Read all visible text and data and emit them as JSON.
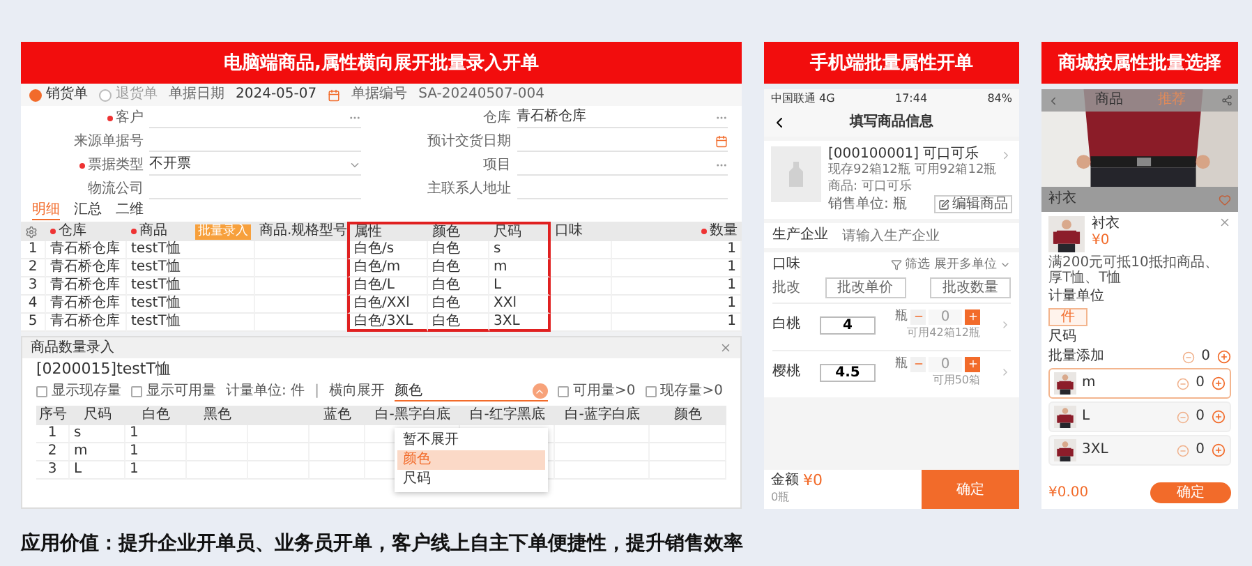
{
  "desktop": {
    "heading": "电脑端商品,属性横向展开批量录入开单",
    "bill_types": [
      {
        "label": "销货单",
        "selected": true
      },
      {
        "label": "退货单",
        "selected": false
      }
    ],
    "date_label": "单据日期",
    "date": "2024-05-07",
    "number_label": "单据编号",
    "number": "SA-20240507-004",
    "fields": [
      {
        "label": "客户",
        "required": true,
        "kind": "lookup"
      },
      {
        "label": "仓库",
        "required": false,
        "value": "青石桥仓库",
        "kind": "lookup"
      },
      {
        "label": "来源单据号",
        "required": false,
        "kind": "text"
      },
      {
        "label": "预计交货日期",
        "required": false,
        "kind": "date"
      },
      {
        "label": "票据类型",
        "required": true,
        "value": "不开票",
        "kind": "select"
      },
      {
        "label": "项目",
        "required": false,
        "kind": "lookup"
      },
      {
        "label": "物流公司",
        "required": false,
        "kind": "text"
      },
      {
        "label": "主联系人地址",
        "required": false,
        "kind": "text"
      }
    ],
    "tabs": [
      {
        "label": "明细",
        "selected": true
      },
      {
        "label": "汇总",
        "selected": false
      },
      {
        "label": "二维",
        "selected": false
      }
    ],
    "columns": [
      {
        "label": "仓库",
        "required": true,
        "highlighted": false
      },
      {
        "label": "商品",
        "required": true,
        "highlighted": false,
        "button": "批量录入"
      },
      {
        "label": "商品.规格型号",
        "required": false,
        "highlighted": false
      },
      {
        "label": "属性",
        "required": false,
        "highlighted": true
      },
      {
        "label": "颜色",
        "required": false,
        "highlighted": true
      },
      {
        "label": "尺码",
        "required": false,
        "highlighted": true
      },
      {
        "label": "口味",
        "required": false,
        "highlighted": false
      },
      {
        "label": "数量",
        "required": true,
        "highlighted": false
      }
    ],
    "rows": [
      {
        "no": "1",
        "cells": [
          "青石桥仓库",
          "testT恤",
          null,
          "白色/s",
          "白色",
          "s",
          null,
          "1"
        ]
      },
      {
        "no": "2",
        "cells": [
          "青石桥仓库",
          "testT恤",
          null,
          "白色/m",
          "白色",
          "m",
          null,
          "1"
        ]
      },
      {
        "no": "3",
        "cells": [
          "青石桥仓库",
          "testT恤",
          null,
          "白色/L",
          "白色",
          "L",
          null,
          "1"
        ]
      },
      {
        "no": "4",
        "cells": [
          "青石桥仓库",
          "testT恤",
          null,
          "白色/XXl",
          "白色",
          "XXl",
          null,
          "1"
        ]
      },
      {
        "no": "5",
        "cells": [
          "青石桥仓库",
          "testT恤",
          null,
          "白色/3XL",
          "白色",
          "3XL",
          null,
          "1"
        ]
      }
    ],
    "dialog": {
      "title": "商品数量录入",
      "product": "[0200015]testT恤",
      "show_checks": [
        {
          "label": "显示现存量",
          "checked": false
        },
        {
          "label": "显示可用量",
          "checked": false
        }
      ],
      "unit": "计量单位: 件",
      "separator": "|",
      "expand_label": "横向展开",
      "expand_value": "颜色",
      "filter_checks": [
        {
          "label": "可用量>0",
          "checked": false
        },
        {
          "label": "现存量>0",
          "checked": false
        }
      ],
      "columns": [
        {
          "label": "序号"
        },
        {
          "label": "尺码"
        },
        {
          "label": "白色"
        },
        {
          "label": "黑色"
        },
        {},
        {
          "label": "蓝色"
        },
        {
          "label": "白-黑字白底"
        },
        {
          "label": "白-红字黑底"
        },
        {
          "label": "白-蓝字白底"
        },
        {
          "label": "颜色"
        }
      ],
      "rows": [
        [
          "1",
          "s",
          "1"
        ],
        [
          "2",
          "m",
          "1"
        ],
        [
          "3",
          "L",
          "1"
        ]
      ],
      "dropdown": [
        {
          "label": "暂不展开",
          "selected": false
        },
        {
          "label": "颜色",
          "selected": true
        },
        {
          "label": "尺码",
          "selected": false
        }
      ]
    }
  },
  "mobile": {
    "heading": "手机端批量属性开单",
    "status": {
      "carrier": "中国联通 4G",
      "time": "17:44",
      "battery": "84%"
    },
    "title": "填写商品信息",
    "product": {
      "name": "[000100001] 可口可乐",
      "stock": "现存92箱12瓶 可用92箱12瓶",
      "item": "商品: 可口可乐",
      "unit": "销售单位: 瓶",
      "edit": "编辑商品"
    },
    "producer": {
      "label": "生产企业",
      "placeholder": "请输入生产企业"
    },
    "attr_label": "口味",
    "filter": "筛选 展开多单位",
    "batch_label": "批改",
    "batch_buttons": [
      "批改单价",
      "批改数量"
    ],
    "rows": [
      {
        "name": "白桃",
        "price": "4",
        "unit": "瓶",
        "qty": "0",
        "available": "可用42箱12瓶"
      },
      {
        "name": "樱桃",
        "price": "4.5",
        "unit": "瓶",
        "qty": "0",
        "available": "可用50箱"
      }
    ],
    "footer": {
      "amount_label": "金额",
      "amount": "¥0",
      "count": "0瓶",
      "confirm": "确定"
    }
  },
  "shop": {
    "heading": "商城按属性批量选择",
    "nav": [
      {
        "label": "商品",
        "selected": false
      },
      {
        "label": "推荐",
        "selected": true
      }
    ],
    "product_title": "衬衣",
    "sheet": {
      "name": "衬衣",
      "price": "¥0",
      "promo": "满200元可抵10抵扣商品、厚T恤、T恤",
      "unit_label": "计量单位",
      "units": [
        {
          "label": "件",
          "selected": true
        }
      ],
      "size_label": "尺码",
      "bulk_label": "批量添加",
      "bulk_qty": "0",
      "items": [
        {
          "name": "m",
          "qty": "0",
          "selected": true
        },
        {
          "name": "L",
          "qty": "0",
          "selected": false
        },
        {
          "name": "3XL",
          "qty": "0",
          "selected": false
        }
      ],
      "total": "¥0.00",
      "confirm": "确定"
    }
  },
  "caption": "应用价值：提升企业开单员、业务员开单，客户线上自主下单便捷性，提升销售效率"
}
